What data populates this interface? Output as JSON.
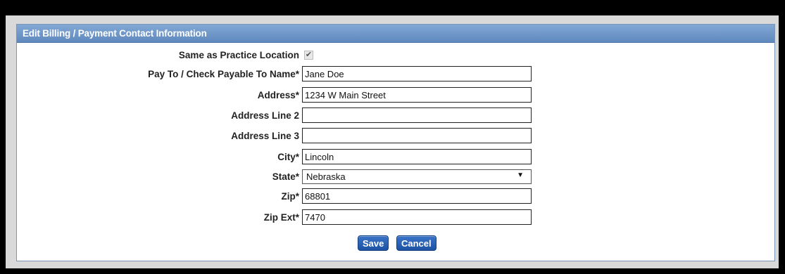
{
  "dialog": {
    "title": "Edit Billing / Payment Contact Information"
  },
  "form": {
    "same_as_label": "Same as Practice Location",
    "same_as_checked": "✔",
    "pay_to_label": "Pay To / Check Payable To Name*",
    "pay_to_value": "Jane Doe",
    "address_label": "Address*",
    "address_value": "1234 W Main Street",
    "address2_label": "Address Line 2",
    "address2_value": "",
    "address3_label": "Address Line 3",
    "address3_value": "",
    "city_label": "City*",
    "city_value": "Lincoln",
    "state_label": "State*",
    "state_value": "Nebraska",
    "state_arrow": "▼",
    "zip_label": "Zip*",
    "zip_value": "68801",
    "zipext_label": "Zip Ext*",
    "zipext_value": "7470"
  },
  "buttons": {
    "save": "Save",
    "cancel": "Cancel"
  },
  "colors": {
    "titlebar": "#6f97c8",
    "button": "#2a62b5"
  }
}
